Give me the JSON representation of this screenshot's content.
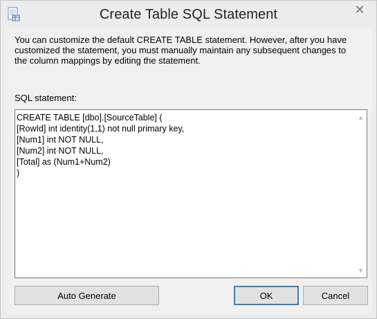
{
  "window": {
    "title": "Create Table SQL Statement",
    "close_glyph": "✕",
    "icon": "document-icon"
  },
  "dialog": {
    "description": "You can customize the default CREATE TABLE statement. However, after you have customized the statement, you must manually maintain any subsequent changes to the column mappings by editing the statement.",
    "sql_label": "SQL statement:",
    "sql_statement": "CREATE TABLE [dbo].[SourceTable] (\n[RowId] int identity(1,1) not null primary key,\n[Num1] int NOT NULL,\n[Num2] int NOT NULL,\n[Total] as (Num1+Num2)\n)"
  },
  "buttons": {
    "auto_generate": "Auto Generate",
    "ok": "OK",
    "cancel": "Cancel"
  }
}
